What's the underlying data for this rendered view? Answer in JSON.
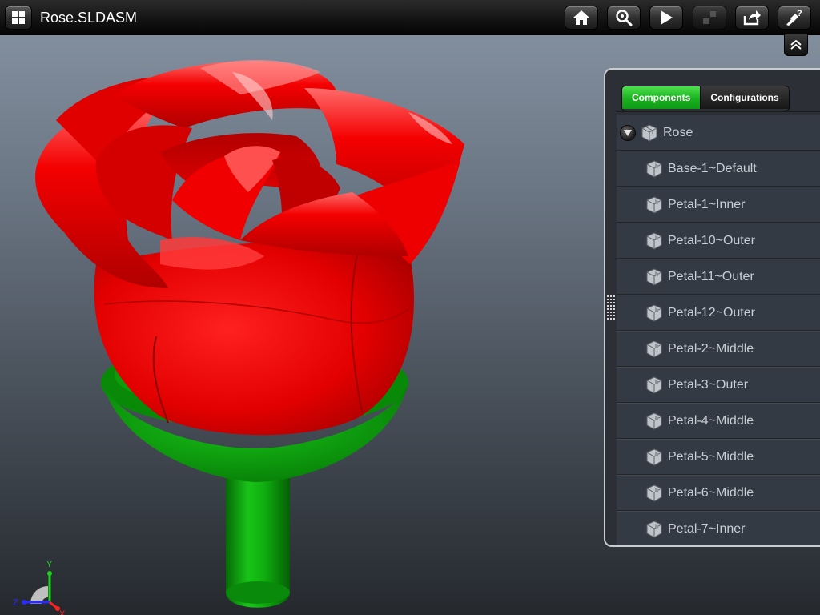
{
  "header": {
    "title": "Rose.SLDASM",
    "menu_icon": "grid-menu-icon",
    "buttons": [
      {
        "id": "home",
        "icon": "home-icon"
      },
      {
        "id": "zoom",
        "icon": "zoom-icon"
      },
      {
        "id": "play",
        "icon": "play-icon"
      },
      {
        "id": "explode",
        "icon": "explode-icon",
        "disabled": true
      },
      {
        "id": "share",
        "icon": "share-icon"
      },
      {
        "id": "help",
        "icon": "help-icon"
      }
    ]
  },
  "panel": {
    "tabs": [
      {
        "label": "Components",
        "active": true
      },
      {
        "label": "Configurations",
        "active": false
      }
    ],
    "tree": {
      "root": "Rose",
      "children": [
        "Base-1~Default",
        "Petal-1~Inner",
        "Petal-10~Outer",
        "Petal-11~Outer",
        "Petal-12~Outer",
        "Petal-2~Middle",
        "Petal-3~Outer",
        "Petal-4~Middle",
        "Petal-5~Middle",
        "Petal-6~Middle",
        "Petal-7~Inner"
      ]
    }
  },
  "triad": {
    "x": "X",
    "y": "Y",
    "z": "Z"
  },
  "colors": {
    "petal": "#e00000",
    "petal_highlight": "#ff3030",
    "stem": "#0a9a0a",
    "active_tab": "#19b21f"
  }
}
